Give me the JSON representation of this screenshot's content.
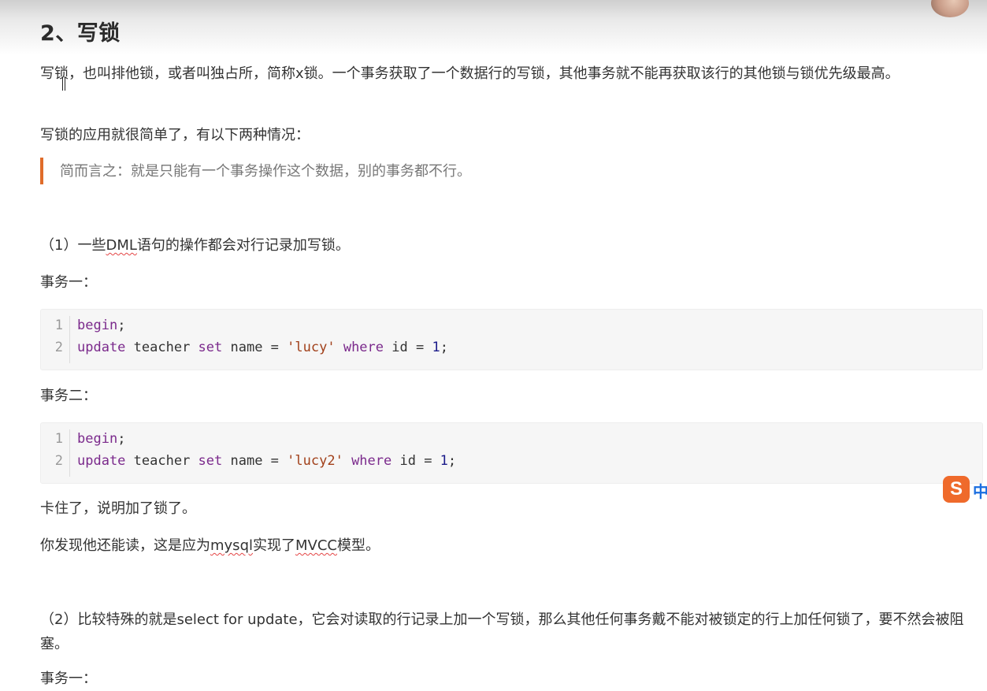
{
  "heading": "2、写锁",
  "p_intro": "写锁，也叫排他锁，或者叫独占所，简称x锁。一个事务获取了一个数据行的写锁，其他事务就不能再获取该行的其他锁与锁优先级最高。",
  "p_usage": "写锁的应用就很简单了，有以下两种情况：",
  "blockquote": "简而言之：就是只能有一个事务操作这个数据，别的事务都不行。",
  "case1": {
    "prefix": "（1）一些",
    "dml": "DML",
    "suffix": "语句的操作都会对行记录加写锁。"
  },
  "txn1_label": "事务一：",
  "code1": {
    "line_numbers": [
      "1",
      "2"
    ],
    "l1_kw": "begin",
    "l1_end": ";",
    "l2_kw1": "update",
    "l2_t1": " teacher ",
    "l2_kw2": "set",
    "l2_t2": " name = ",
    "l2_str": "'lucy'",
    "l2_sp": " ",
    "l2_kw3": "where",
    "l2_t3": " id = ",
    "l2_num": "1",
    "l2_end": ";"
  },
  "txn2_label": "事务二：",
  "code2": {
    "line_numbers": [
      "1",
      "2"
    ],
    "l1_kw": "begin",
    "l1_end": ";",
    "l2_kw1": "update",
    "l2_t1": " teacher ",
    "l2_kw2": "set",
    "l2_t2": " name = ",
    "l2_str": "'lucy2'",
    "l2_sp": " ",
    "l2_kw3": "where",
    "l2_t3": " id = ",
    "l2_num": "1",
    "l2_end": ";"
  },
  "blocked": "卡住了，说明加了锁了。",
  "mvcc": {
    "prefix": "你发现他还能读，这是应为",
    "mysql": "mysql",
    "middle": "实现了",
    "mvcc": "MVCC",
    "suffix": "模型。"
  },
  "case2": "（2）比较特殊的就是select for update，它会对读取的行记录上加一个写锁，那么其他任何事务戴不能对被锁定的行上加任何锁了，要不然会被阻塞。",
  "next_label": "事务一：",
  "ime": {
    "logo": "S",
    "lang": "中"
  }
}
